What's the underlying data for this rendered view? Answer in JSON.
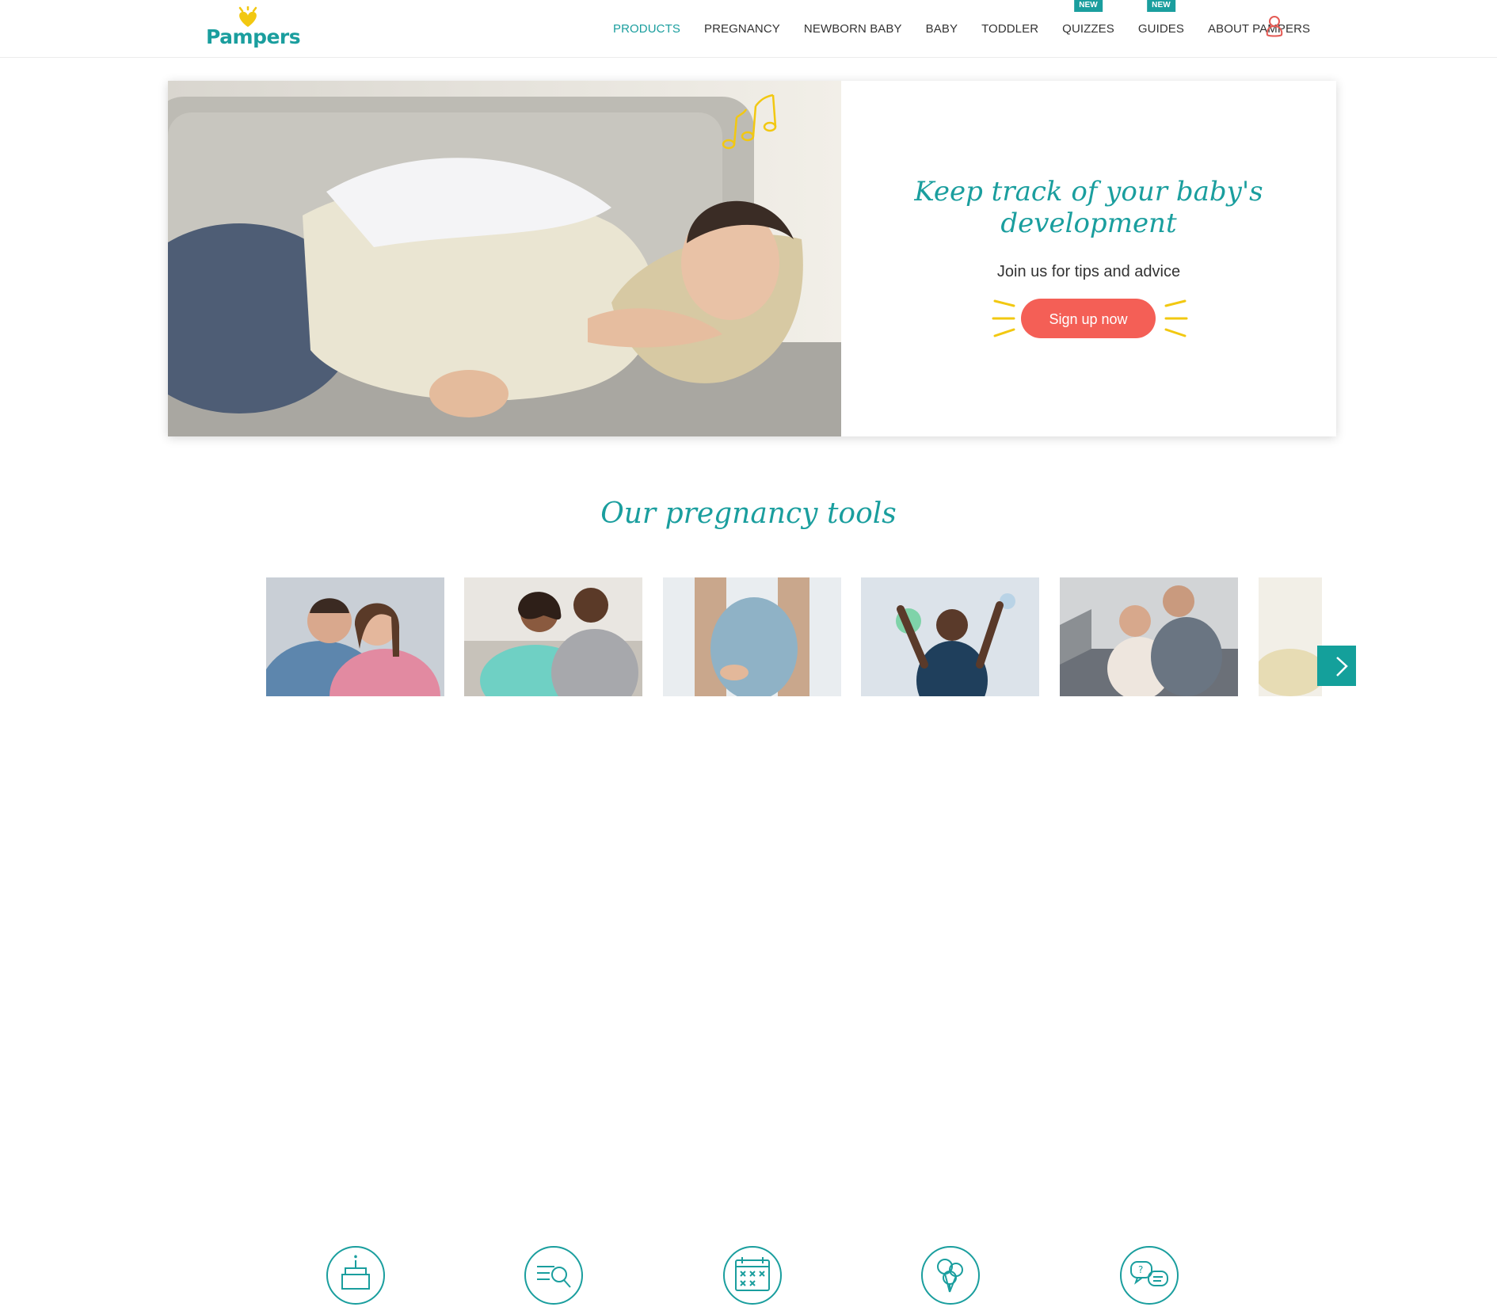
{
  "brand": {
    "logo_text": "Pampers",
    "primary_color": "#1a9e9e",
    "accent_color": "#f45f56",
    "highlight_color": "#f2c811"
  },
  "nav": {
    "items": [
      {
        "label": "PRODUCTS",
        "active": true
      },
      {
        "label": "PREGNANCY"
      },
      {
        "label": "NEWBORN BABY"
      },
      {
        "label": "BABY"
      },
      {
        "label": "TODDLER"
      },
      {
        "label": "QUIZZES",
        "badge": "NEW"
      },
      {
        "label": "GUIDES",
        "badge": "NEW"
      },
      {
        "label": "ABOUT PAMPERS"
      }
    ],
    "account_icon": "user-icon"
  },
  "hero": {
    "title_line1": "Keep track of your baby's",
    "title_line2": "development",
    "subtitle": "Join us for tips and advice",
    "cta": "Sign up now",
    "decoration_icon": "music-notes-icon"
  },
  "tools": {
    "title": "Our pregnancy tools",
    "cards": [
      {
        "icon": "birthday-cake-icon"
      },
      {
        "icon": "magnifier-document-icon"
      },
      {
        "icon": "calendar-icon"
      },
      {
        "icon": "balloons-icon"
      },
      {
        "icon": "speech-bubbles-question-icon"
      },
      {
        "icon": "partial-card"
      }
    ],
    "next_icon": "chevron-right-icon"
  }
}
